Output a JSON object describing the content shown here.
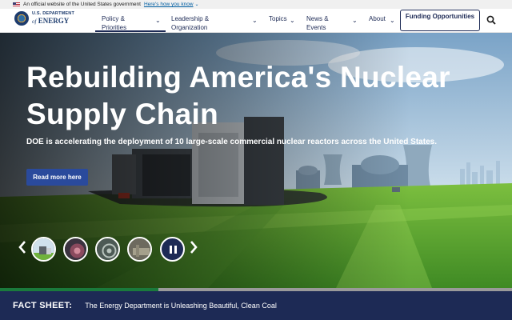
{
  "banner": {
    "text": "An official website of the United States government",
    "link": "Here's how you know"
  },
  "logo": {
    "line1": "U.S. DEPARTMENT",
    "of": "of",
    "line2": "ENERGY"
  },
  "nav": {
    "items": [
      {
        "label": "Policy & Priorities"
      },
      {
        "label": "Leadership & Organization"
      },
      {
        "label": "Topics"
      },
      {
        "label": "News & Events"
      },
      {
        "label": "About"
      }
    ],
    "cta": "Funding Opportunities"
  },
  "hero": {
    "title": "Rebuilding America's Nuclear Supply Chain",
    "subtitle": "DOE is accelerating the deployment of 10 large-scale commercial nuclear reactors across the United States.",
    "button": "Read more here"
  },
  "carousel": {
    "progress_fraction": 0.31
  },
  "fact_sheet": {
    "label": "FACT SHEET:",
    "text": "The Energy Department is Unleashing Beautiful, Clean Coal"
  },
  "colors": {
    "navy": "#1d2a55",
    "button_blue": "#2a4a9c",
    "progress_green": "#1a7a3c"
  }
}
